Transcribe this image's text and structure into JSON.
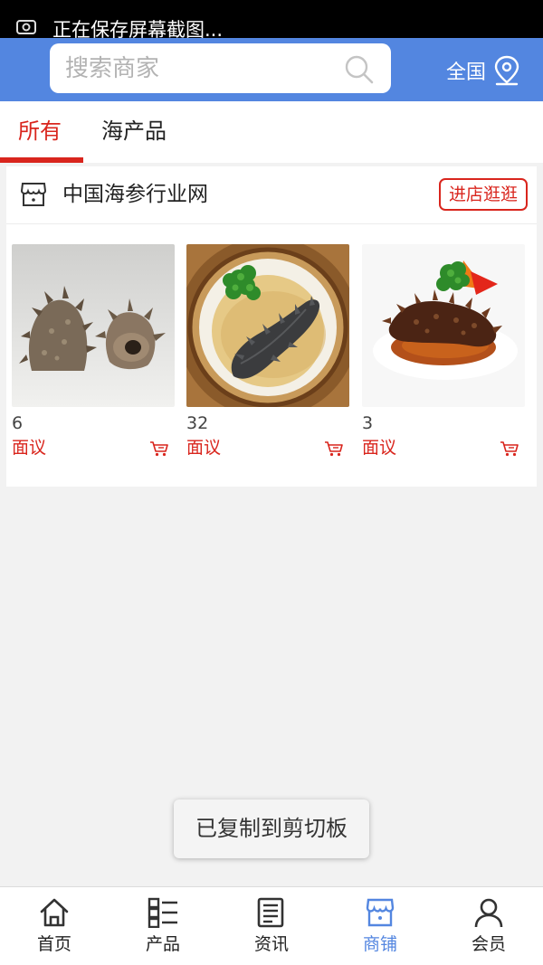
{
  "status_bar": {
    "text": "正在保存屏幕截图..."
  },
  "search": {
    "placeholder": "搜索商家"
  },
  "region": {
    "label": "全国"
  },
  "tabs": [
    {
      "label": "所有",
      "active": true
    },
    {
      "label": "海产品",
      "active": false
    }
  ],
  "shop": {
    "name": "中国海参行业网",
    "visit_label": "进店逛逛",
    "products": [
      {
        "price": "6",
        "price_note": "面议",
        "image": "sea-cucumber-cut-halves"
      },
      {
        "price": "32",
        "price_note": "面议",
        "image": "sea-cucumber-braised-plate"
      },
      {
        "price": "3",
        "price_note": "面议",
        "image": "sea-cucumber-braised-sauce"
      }
    ]
  },
  "toast": {
    "text": "已复制到剪切板"
  },
  "bottom_nav": [
    {
      "label": "首页",
      "icon": "home-icon",
      "active": false
    },
    {
      "label": "产品",
      "icon": "grid-list-icon",
      "active": false
    },
    {
      "label": "资讯",
      "icon": "news-icon",
      "active": false
    },
    {
      "label": "商铺",
      "icon": "shop-icon",
      "active": true
    },
    {
      "label": "会员",
      "icon": "user-icon",
      "active": false
    }
  ],
  "colors": {
    "primary": "#5386e0",
    "accent": "#d9251d",
    "background": "#f2f2f2"
  }
}
